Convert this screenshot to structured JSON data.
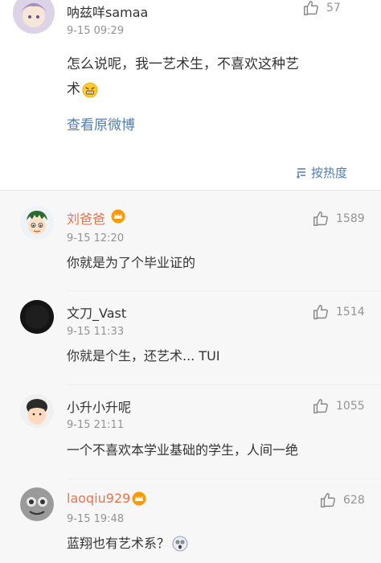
{
  "top_comment": {
    "username": "呐兹咩samaa",
    "time": "9-15 09:29",
    "likes": "57",
    "text_line1": "怎么说呢，我一艺术生，不喜欢这种艺",
    "text_line2": "术",
    "view_original": "查看原微博",
    "sort_label": "按热度"
  },
  "replies": [
    {
      "username": "刘爸爸",
      "time": "9-15 12:20",
      "likes": "1589",
      "text": "你就是为了个毕业证的"
    },
    {
      "username": "文刀_Vast",
      "time": "9-15 11:33",
      "likes": "1514",
      "text": "你就是个生，还艺术... TUI"
    },
    {
      "username": "小升小升呢",
      "time": "9-15 21:11",
      "likes": "1055",
      "text": "一个不喜欢本学业基础的学生，人间一绝"
    },
    {
      "username": "laoqiu929",
      "time": "9-15 19:48",
      "likes": "628",
      "text": "蓝翔也有艺术系？"
    }
  ],
  "colors": {
    "vip_name": "#eb7350",
    "link": "#507daf",
    "gray_text": "#939393",
    "reply_bg": "#f7f7f7"
  }
}
